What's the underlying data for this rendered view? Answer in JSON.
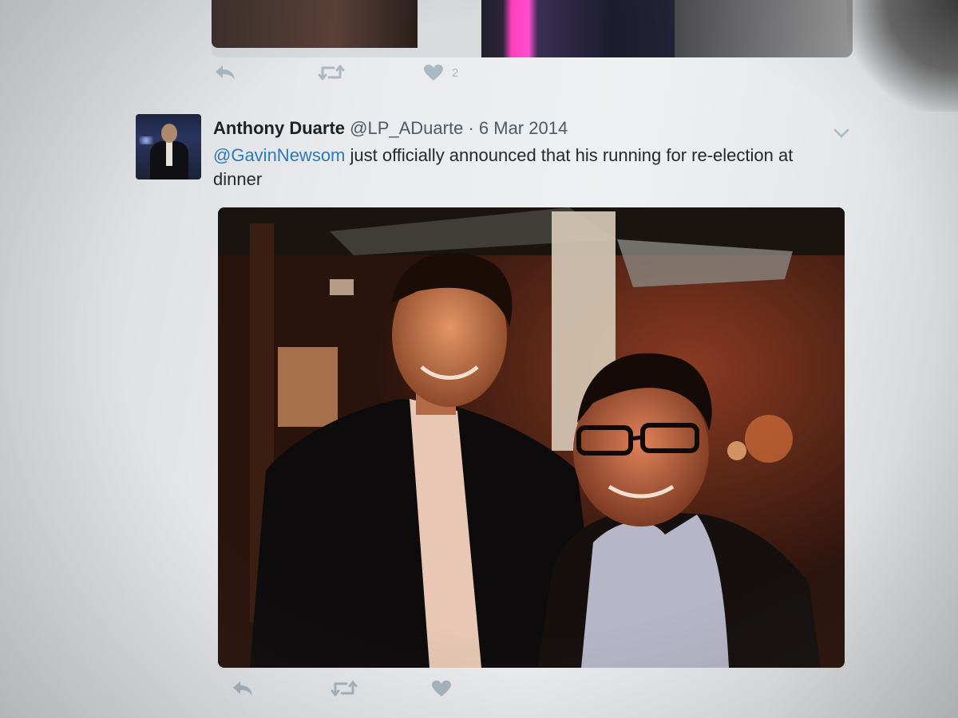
{
  "previous_tweet": {
    "like_count": "2"
  },
  "tweet": {
    "author_name": "Anthony Duarte",
    "handle": "@LP_ADuarte",
    "separator": "·",
    "date": "6 Mar 2014",
    "mention": "@GavinNewsom",
    "text": " just officially announced that his running for re-election at dinner"
  },
  "icons": {
    "reply": "reply-icon",
    "retweet": "retweet-icon",
    "like": "heart-icon",
    "more": "chevron-down-icon"
  },
  "colors": {
    "icon_gray": "#aab8c2",
    "mention_blue": "#2b7bb9",
    "name_text": "#1c2126",
    "meta_text": "#4f5a63"
  }
}
